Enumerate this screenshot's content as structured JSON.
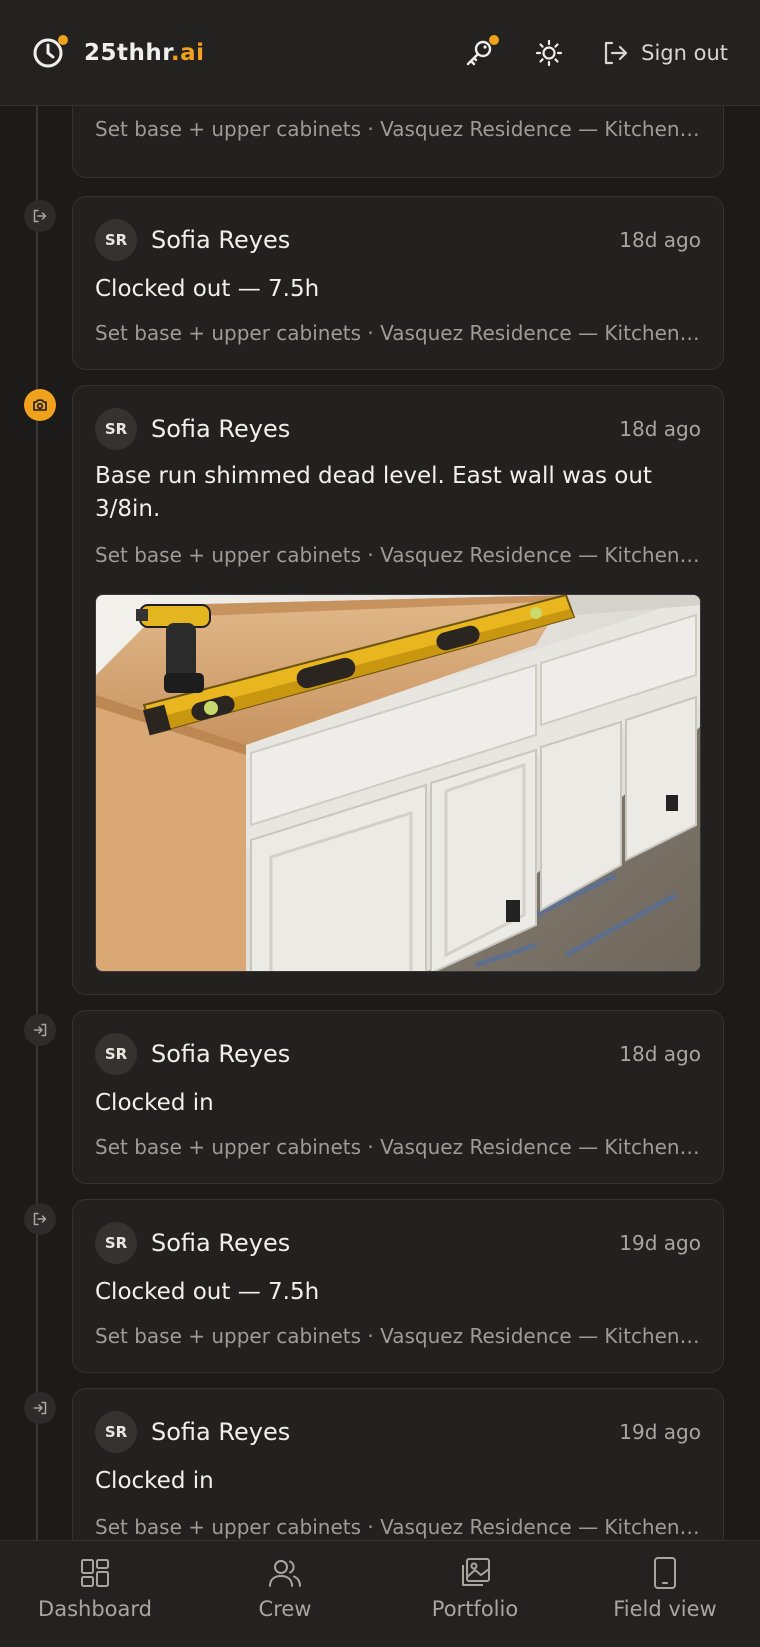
{
  "header": {
    "brand_main": "25thhr",
    "brand_accent": ".ai",
    "signout_label": "Sign out",
    "brand_color": "#f0a21c"
  },
  "feed": {
    "entries": [
      {
        "type": "clock-in",
        "event": "",
        "meta": "Set base + upper cabinets · Vasquez Residence — Kitchen Remodel"
      },
      {
        "type": "clock-out",
        "initials": "SR",
        "author": "Sofia Reyes",
        "time": "18d ago",
        "event": "Clocked out — 7.5h",
        "meta": "Set base + upper cabinets · Vasquez Residence — Kitchen Remodel"
      },
      {
        "type": "photo",
        "initials": "SR",
        "author": "Sofia Reyes",
        "time": "18d ago",
        "event": "Base run shimmed dead level. East wall was out 3/8in.",
        "meta": "Set base + upper cabinets · Vasquez Residence — Kitchen Remodel"
      },
      {
        "type": "clock-in",
        "initials": "SR",
        "author": "Sofia Reyes",
        "time": "18d ago",
        "event": "Clocked in",
        "meta": "Set base + upper cabinets · Vasquez Residence — Kitchen Remodel"
      },
      {
        "type": "clock-out",
        "initials": "SR",
        "author": "Sofia Reyes",
        "time": "19d ago",
        "event": "Clocked out — 7.5h",
        "meta": "Set base + upper cabinets · Vasquez Residence — Kitchen Remodel"
      },
      {
        "type": "clock-in",
        "initials": "SR",
        "author": "Sofia Reyes",
        "time": "19d ago",
        "event": "Clocked in",
        "meta": "Set base + upper cabinets · Vasquez Residence — Kitchen Remodel"
      }
    ]
  },
  "nav": {
    "items": [
      {
        "label": "Dashboard",
        "icon": "dashboard-icon"
      },
      {
        "label": "Crew",
        "icon": "crew-icon"
      },
      {
        "label": "Portfolio",
        "icon": "portfolio-icon"
      },
      {
        "label": "Field view",
        "icon": "phone-icon"
      }
    ]
  }
}
